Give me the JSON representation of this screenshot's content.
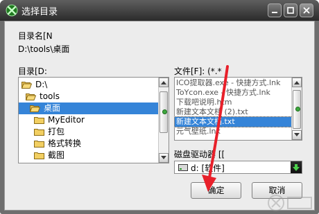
{
  "window": {
    "title": "选择目录"
  },
  "directory_name": {
    "label": "目录名[N",
    "path": "D:\\tools\\桌面"
  },
  "directories": {
    "label": "目录[D:",
    "items": [
      {
        "label": "D:\\",
        "icon": "open-folder-icon",
        "selected": false
      },
      {
        "label": "tools",
        "icon": "open-folder-icon",
        "selected": false
      },
      {
        "label": "桌面",
        "icon": "open-folder-icon",
        "selected": true
      },
      {
        "label": "MyEditor",
        "icon": "folder-icon",
        "selected": false
      },
      {
        "label": "打包",
        "icon": "folder-icon",
        "selected": false
      },
      {
        "label": "格式转换",
        "icon": "folder-icon",
        "selected": false
      },
      {
        "label": "截图",
        "icon": "folder-icon",
        "selected": false
      }
    ]
  },
  "files": {
    "label": "文件[F]: (*.*",
    "items": [
      {
        "label": "ICO提取器.exe - 快捷方式.lnk",
        "selected": false
      },
      {
        "label": "ToYcon.exe - 快捷方式.lnk",
        "selected": false
      },
      {
        "label": "下载吧说明.htm",
        "selected": false
      },
      {
        "label": "新建文本文档 (2).txt",
        "selected": false
      },
      {
        "label": "新建文本文档.txt",
        "selected": true
      },
      {
        "label": "元气壁纸.lnk",
        "selected": false
      }
    ]
  },
  "drives": {
    "label": "磁盘驱动器 [[",
    "value": "d: [软件]"
  },
  "buttons": {
    "ok": "确定",
    "cancel": "取消"
  },
  "colors": {
    "selection": "#3584d8",
    "annotation_arrow": "#e8202a"
  }
}
